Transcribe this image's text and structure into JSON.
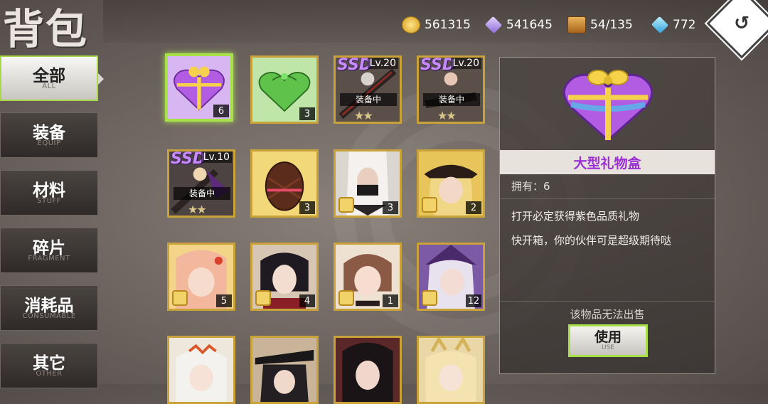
{
  "header": {
    "title": "背包"
  },
  "resources": [
    {
      "icon": "gold-coin-icon",
      "value": "561315"
    },
    {
      "icon": "crystal-icon",
      "value": "541645"
    },
    {
      "icon": "treasure-chest-icon",
      "value": "54/135"
    },
    {
      "icon": "diamond-icon",
      "value": "772"
    }
  ],
  "back_button": {
    "glyph": "↺"
  },
  "tabs": [
    {
      "label": "全部",
      "sub": "ALL",
      "active": true
    },
    {
      "label": "装备",
      "sub": "EQUIP"
    },
    {
      "label": "材料",
      "sub": "STUFF"
    },
    {
      "label": "碎片",
      "sub": "FRAGMENT"
    },
    {
      "label": "消耗品",
      "sub": "CONSUMABLE"
    },
    {
      "label": "其它",
      "sub": "OTHER"
    }
  ],
  "items": [
    {
      "kind": "gift-box",
      "count": "6",
      "selected": true
    },
    {
      "kind": "green-gift-box",
      "count": "3"
    },
    {
      "kind": "weapon",
      "grade": "SSD",
      "level": "Lv.20",
      "status": "装备中"
    },
    {
      "kind": "weapon",
      "grade": "SSD",
      "level": "Lv.20",
      "status": "装备中"
    },
    {
      "kind": "weapon",
      "grade": "SSD",
      "level": "Lv.10",
      "status": "装备中"
    },
    {
      "kind": "chocolate-egg",
      "count": "3"
    },
    {
      "kind": "character-fragment",
      "count": "3"
    },
    {
      "kind": "character-fragment",
      "count": "2"
    },
    {
      "kind": "character-fragment",
      "count": "5"
    },
    {
      "kind": "character-fragment",
      "count": "4"
    },
    {
      "kind": "character-fragment",
      "count": "1"
    },
    {
      "kind": "character-fragment",
      "count": "12"
    },
    {
      "kind": "character-portrait",
      "count": ""
    },
    {
      "kind": "character-portrait",
      "count": ""
    },
    {
      "kind": "character-portrait",
      "count": ""
    },
    {
      "kind": "character-portrait",
      "count": ""
    }
  ],
  "detail": {
    "name": "大型礼物盒",
    "owned_label": "拥有：6",
    "desc1": "打开必定获得紫色品质礼物",
    "desc2": "快开箱，你的伙伴可是超级期待哒",
    "no_sell": "该物品无法出售",
    "use_label": "使用",
    "use_sub": "USE"
  }
}
